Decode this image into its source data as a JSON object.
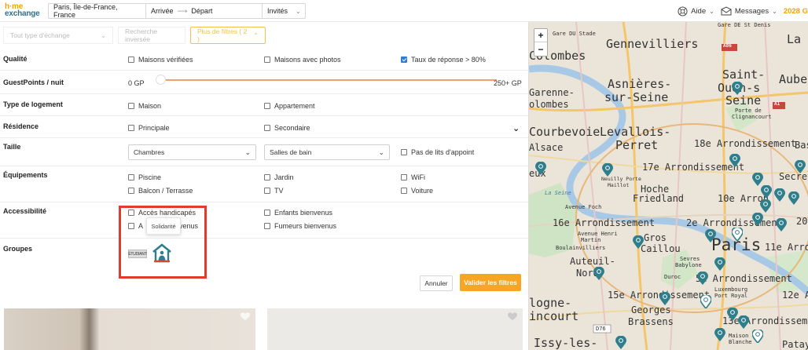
{
  "header": {
    "logo_line1": "h·me",
    "logo_line2": "exchange",
    "location": "Paris, Île-de-France, France",
    "arrival": "Arrivée",
    "departure": "Départ",
    "guests": "Invités",
    "help": "Aide",
    "messages": "Messages",
    "guestpoints": "2028 G"
  },
  "topfilters": {
    "type": "Tout type d'échange",
    "reverse": "Recherche inversée",
    "more": "Plus de filtres ( 2 )"
  },
  "filters": {
    "quality": {
      "label": "Qualité",
      "options": [
        "Maisons vérifiées",
        "Maisons avec photos",
        "Taux de réponse > 80%"
      ],
      "checked": [
        false,
        false,
        true
      ]
    },
    "guestpoints": {
      "label": "GuestPoints / nuit",
      "min": "0 GP",
      "max": "250+ GP"
    },
    "type": {
      "label": "Type de logement",
      "options": [
        "Maison",
        "Appartement"
      ]
    },
    "residence": {
      "label": "Résidence",
      "options": [
        "Principale",
        "Secondaire"
      ]
    },
    "size": {
      "label": "Taille",
      "bedrooms": "Chambres",
      "bathrooms": "Salles de bain",
      "no_extra_beds": "Pas de lits d'appoint"
    },
    "equipment": {
      "label": "Équipements",
      "options": [
        "Piscine",
        "Jardin",
        "WiFi",
        "Balcon / Terrasse",
        "TV",
        "Voiture"
      ]
    },
    "accessibility": {
      "label": "Accessibilité",
      "opt1": "Accès handicapés",
      "opt2_start": "A",
      "opt2_end": "venus",
      "opt3": "Enfants bienvenus",
      "opt4": "Fumeurs bienvenus"
    },
    "groups": {
      "label": "Groupes",
      "tooltip": "Solidarité",
      "badge_text": "ÉTUDIANT"
    }
  },
  "actions": {
    "cancel": "Annuler",
    "apply": "Valider les filtres"
  },
  "map": {
    "zoom_in": "+",
    "zoom_out": "−",
    "labels": {
      "gare_stade": "Gare DU Stade",
      "gare_denis": "Gare DE St Denis",
      "gennevilliers": "Gennevilliers",
      "la": "La C",
      "colombes": "Colombes",
      "a86": "A86",
      "saint": "Saint-",
      "ouen": "Ouen-s",
      "seine1": "Seine",
      "aube": "Aube",
      "asnieres": "Asnières-",
      "sur_seine": "sur-Seine",
      "garenne": "Garenne-",
      "olombes": "olombes",
      "a1": "A1",
      "porte_clign": "Porte de",
      "clignancourt": "Clignancourt",
      "courbevoie": "Courbevoie",
      "levallois": "Levallois-",
      "perret": "Perret",
      "e18": "18e Arrondissement",
      "bas": "Bas",
      "alsace": "Alsace",
      "e17": "17e Arrondissement",
      "eux": "eux",
      "neuilly": "Neuilly Porte",
      "maillot": "Maillot",
      "hoche": "Hoche",
      "secret": "Secret",
      "la_seine": "La Seine",
      "friedland": "Friedland",
      "e10": "10e Arron",
      "avenue_foch": "Avenue Foch",
      "e16": "16e Arrondissement",
      "e2": "2e Arrondissement",
      "e20": "20",
      "avenue_henri": "Avenue Henri",
      "martin": "Martin",
      "gros": "Gros",
      "caillou": "Caillou",
      "paris": "Paris",
      "e11": "11e Arron",
      "boulainvilliers": "Boulainvilliers",
      "auteuil": "Auteuil-",
      "nord": "Nord",
      "sevres": "Sevres",
      "babylone": "Babylone",
      "duroc": "Duroc",
      "e5": "5e Arrondissement",
      "luxembourg": "Luxembourg",
      "port_royal": "Port Royal",
      "e15": "15e Arrondissement",
      "e12": "12e Ar",
      "logne": "logne-",
      "georges": "Georges",
      "brassens": "Brassens",
      "incourt": "incourt",
      "e13": "13e Arrondissement",
      "d76": "D76",
      "maison": "Maison",
      "blanche": "Blanche",
      "issy": "Issy-les-",
      "patay": "Patay"
    }
  }
}
